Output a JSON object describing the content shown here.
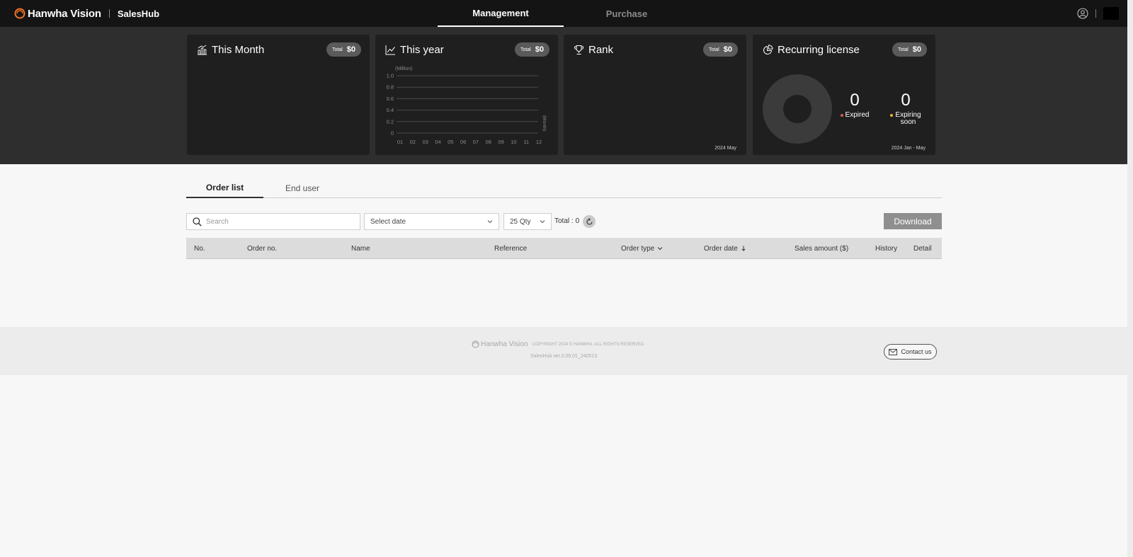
{
  "header": {
    "brand_name": "Hanwha Vision",
    "app_name": "SalesHub",
    "nav": [
      {
        "label": "Management",
        "active": true
      },
      {
        "label": "Purchase",
        "active": false
      }
    ]
  },
  "cards": {
    "this_month": {
      "title": "This Month",
      "total_label": "Total",
      "total_value": "$0"
    },
    "this_year": {
      "title": "This year",
      "total_label": "Total",
      "total_value": "$0"
    },
    "rank": {
      "title": "Rank",
      "total_label": "Total",
      "total_value": "$0",
      "period": "2024 May"
    },
    "recurring": {
      "title": "Recurring license",
      "total_label": "Total",
      "total_value": "$0",
      "expired": {
        "value": "0",
        "label": "Expired"
      },
      "expiring": {
        "value": "0",
        "label_line1": "Expiring",
        "label_line2": "soon"
      },
      "period": "2024 Jan - May"
    }
  },
  "chart_data": {
    "type": "line",
    "ylabel": "(Million)",
    "xlabel": "(Month)",
    "categories": [
      "01",
      "02",
      "03",
      "04",
      "05",
      "06",
      "07",
      "08",
      "09",
      "10",
      "11",
      "12"
    ],
    "series": [],
    "yticks": [
      "1.0",
      "0.8",
      "0.6",
      "0.4",
      "0.2",
      "0"
    ],
    "ylim": [
      0,
      1.0
    ],
    "grid": true
  },
  "tabs": [
    {
      "label": "Order list",
      "active": true
    },
    {
      "label": "End user",
      "active": false
    }
  ],
  "filters": {
    "search_placeholder": "Search",
    "date_select": "Select date",
    "qty_select": "25 Qty",
    "total_text": "Total : 0",
    "download_label": "Download"
  },
  "table": {
    "columns": [
      "No.",
      "Order no.",
      "Name",
      "Reference",
      "Order type",
      "Order date",
      "Sales amount ($)",
      "History",
      "Detail"
    ],
    "rows": []
  },
  "footer": {
    "logo_text": "Hanwha Vision",
    "copyright": "COPYRIGHT 2024 © HANWHA. ALL RIGHTS RESERVED.",
    "version": "SalesHub ver.0.09.01_240513",
    "contact_label": "Contact us"
  },
  "colors": {
    "topbar": "#141414",
    "dash_band": "#2e2e2e",
    "card_bg": "#1f1f1f",
    "expired_dot": "#e05a4e",
    "expiring_dot": "#f2b233"
  }
}
